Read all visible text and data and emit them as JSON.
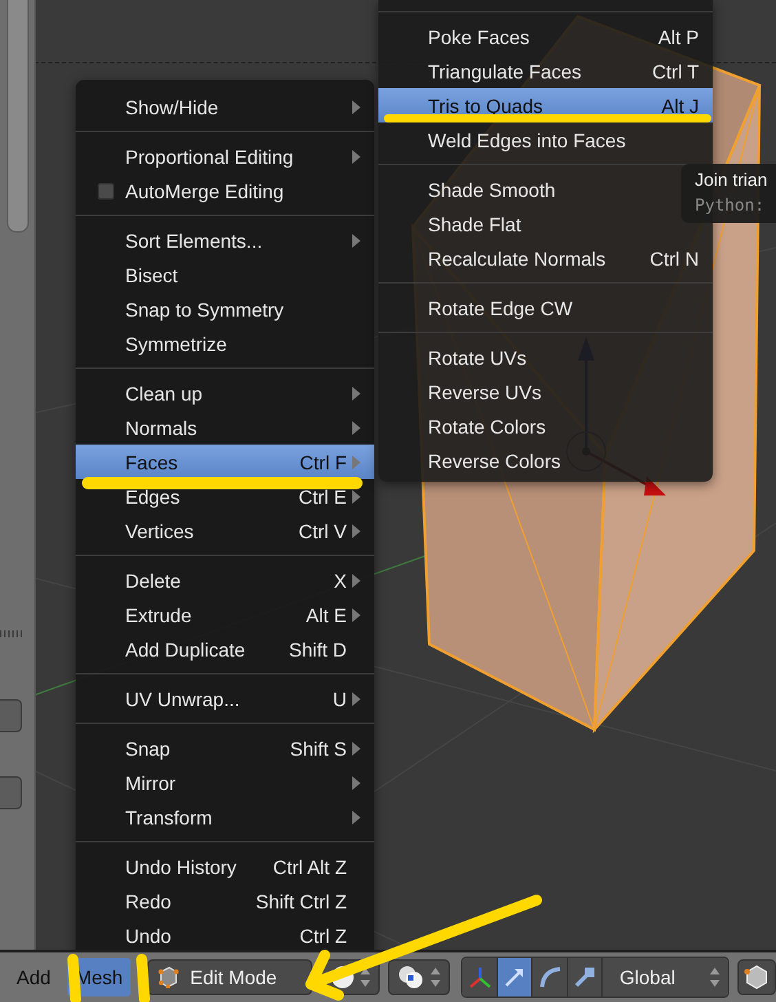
{
  "mesh_menu": {
    "groups": [
      {
        "items": [
          {
            "kind": "item",
            "label": "Show/Hide",
            "submenu": true,
            "selected": false
          }
        ]
      },
      {
        "items": [
          {
            "kind": "item",
            "label": "Proportional Editing",
            "submenu": true,
            "selected": false
          },
          {
            "kind": "check",
            "label": "AutoMerge Editing",
            "checked": false,
            "submenu": false,
            "selected": false
          }
        ]
      },
      {
        "items": [
          {
            "kind": "item",
            "label": "Sort Elements...",
            "submenu": true,
            "selected": false
          },
          {
            "kind": "item",
            "label": "Bisect",
            "submenu": false,
            "selected": false
          },
          {
            "kind": "item",
            "label": "Snap to Symmetry",
            "submenu": false,
            "selected": false
          },
          {
            "kind": "item",
            "label": "Symmetrize",
            "submenu": false,
            "selected": false
          }
        ]
      },
      {
        "items": [
          {
            "kind": "item",
            "label": "Clean up",
            "submenu": true,
            "selected": false
          },
          {
            "kind": "item",
            "label": "Normals",
            "submenu": true,
            "selected": false
          },
          {
            "kind": "item",
            "label": "Faces",
            "shortcut": "Ctrl F",
            "submenu": true,
            "selected": true
          },
          {
            "kind": "item",
            "label": "Edges",
            "shortcut": "Ctrl E",
            "submenu": true,
            "selected": false
          },
          {
            "kind": "item",
            "label": "Vertices",
            "shortcut": "Ctrl V",
            "submenu": true,
            "selected": false
          }
        ]
      },
      {
        "items": [
          {
            "kind": "item",
            "label": "Delete",
            "shortcut": "X",
            "submenu": true,
            "selected": false
          },
          {
            "kind": "item",
            "label": "Extrude",
            "shortcut": "Alt E",
            "submenu": true,
            "selected": false
          },
          {
            "kind": "item",
            "label": "Add Duplicate",
            "shortcut": "Shift D",
            "submenu": false,
            "selected": false
          }
        ]
      },
      {
        "items": [
          {
            "kind": "item",
            "label": "UV Unwrap...",
            "shortcut": "U",
            "submenu": true,
            "selected": false
          }
        ]
      },
      {
        "items": [
          {
            "kind": "item",
            "label": "Snap",
            "shortcut": "Shift S",
            "submenu": true,
            "selected": false
          },
          {
            "kind": "item",
            "label": "Mirror",
            "submenu": true,
            "selected": false
          },
          {
            "kind": "item",
            "label": "Transform",
            "submenu": true,
            "selected": false
          }
        ]
      },
      {
        "items": [
          {
            "kind": "item",
            "label": "Undo History",
            "shortcut": "Ctrl Alt Z",
            "submenu": false,
            "selected": false
          },
          {
            "kind": "item",
            "label": "Redo",
            "shortcut": "Shift Ctrl Z",
            "submenu": false,
            "selected": false
          },
          {
            "kind": "item",
            "label": "Undo",
            "shortcut": "Ctrl Z",
            "submenu": false,
            "selected": false
          }
        ]
      }
    ]
  },
  "faces_menu": {
    "groups": [
      {
        "items": [
          {
            "label": "Poke Faces",
            "shortcut": "Alt P",
            "selected": false
          },
          {
            "label": "Triangulate Faces",
            "shortcut": "Ctrl T",
            "selected": false
          },
          {
            "label": "Tris to Quads",
            "shortcut": "Alt J",
            "selected": true
          },
          {
            "label": "Weld Edges into Faces",
            "selected": false
          }
        ]
      },
      {
        "items": [
          {
            "label": "Shade Smooth",
            "selected": false
          },
          {
            "label": "Shade Flat",
            "selected": false
          },
          {
            "label": "Recalculate Normals",
            "shortcut": "Ctrl N",
            "selected": false
          }
        ]
      },
      {
        "items": [
          {
            "label": "Rotate Edge CW",
            "selected": false
          }
        ]
      },
      {
        "items": [
          {
            "label": "Rotate UVs",
            "selected": false
          },
          {
            "label": "Reverse UVs",
            "selected": false
          },
          {
            "label": "Rotate Colors",
            "selected": false
          },
          {
            "label": "Reverse Colors",
            "selected": false
          }
        ]
      }
    ]
  },
  "tooltip": {
    "title": "Join trian",
    "python": "Python:"
  },
  "header": {
    "menus": [
      {
        "label": "Add",
        "selected": false
      },
      {
        "label": "Mesh",
        "selected": true
      }
    ],
    "mode": "Edit Mode",
    "manipulators": [
      {
        "selected": false
      },
      {
        "selected": true
      },
      {
        "selected": false
      },
      {
        "selected": false
      }
    ],
    "orientation": "Global"
  }
}
